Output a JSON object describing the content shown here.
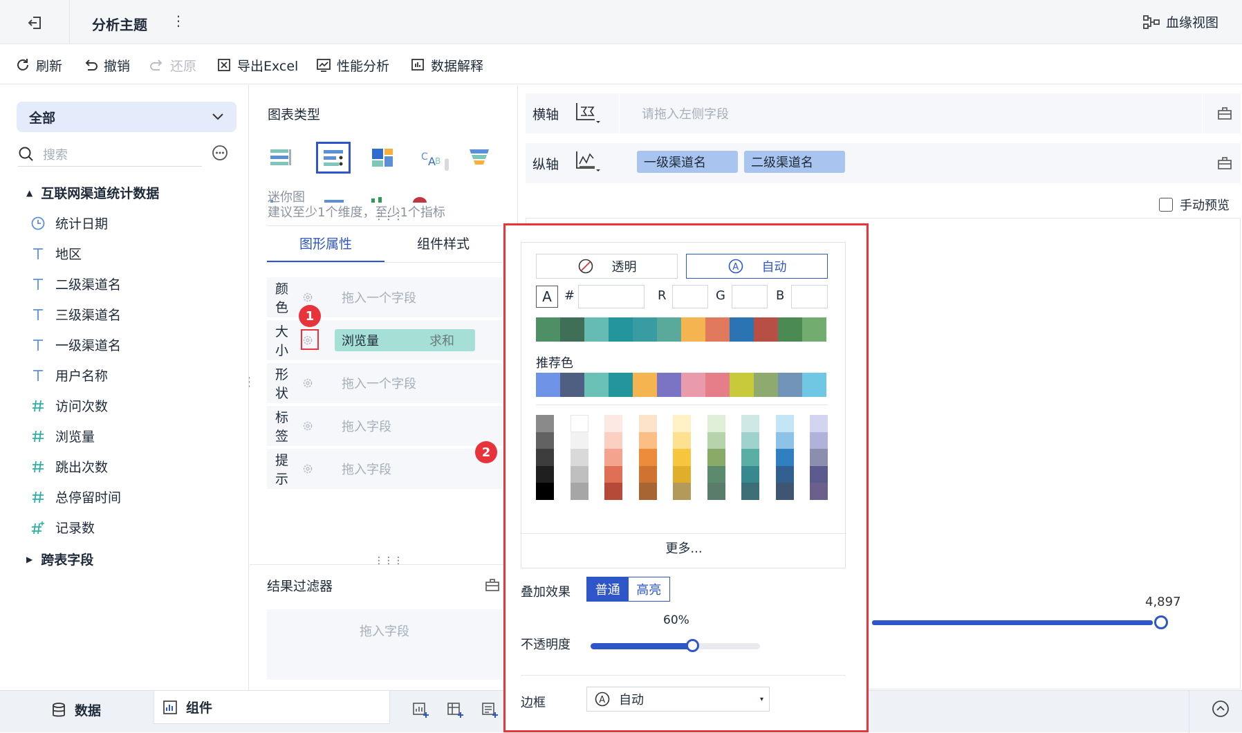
{
  "topbar": {
    "title": "分析主题",
    "more": "⋮",
    "lineage": "血缘视图"
  },
  "toolbar": {
    "refresh": "刷新",
    "undo": "撤销",
    "redo": "还原",
    "export": "导出Excel",
    "perf": "性能分析",
    "explain": "数据解释"
  },
  "left": {
    "dropdown": "全部",
    "search_placeholder": "搜索",
    "group": "互联网渠道统计数据",
    "fields": [
      {
        "label": "统计日期",
        "icon": "clock-icon"
      },
      {
        "label": "地区",
        "icon": "text-field-icon"
      },
      {
        "label": "二级渠道名",
        "icon": "text-field-icon"
      },
      {
        "label": "三级渠道名",
        "icon": "text-field-icon"
      },
      {
        "label": "一级渠道名",
        "icon": "text-field-icon"
      },
      {
        "label": "用户名称",
        "icon": "text-field-icon"
      },
      {
        "label": "访问次数",
        "icon": "number-field-icon"
      },
      {
        "label": "浏览量",
        "icon": "number-field-icon"
      },
      {
        "label": "跳出次数",
        "icon": "number-field-icon"
      },
      {
        "label": "总停留时间",
        "icon": "number-field-icon"
      },
      {
        "label": "记录数",
        "icon": "count-field-icon"
      }
    ],
    "cross_table": "跨表字段"
  },
  "mid": {
    "chart_type_title": "图表类型",
    "mini_name": "迷你图",
    "mini_hint": "建议至少1个维度，至少1个指标",
    "tab_props": "图形属性",
    "tab_style": "组件样式",
    "props": [
      {
        "label": "颜色",
        "placeholder": "拖入一个字段"
      },
      {
        "label": "大小",
        "pill": "浏览量",
        "agg": "求和"
      },
      {
        "label": "形状",
        "placeholder": "拖入一个字段"
      },
      {
        "label": "标签",
        "placeholder": "拖入字段"
      },
      {
        "label": "提示",
        "placeholder": "拖入字段"
      }
    ],
    "filter_title": "结果过滤器",
    "filter_placeholder": "拖入字段"
  },
  "right": {
    "x_axis": "横轴",
    "x_placeholder": "请拖入左侧字段",
    "y_axis": "纵轴",
    "y_pills": [
      "一级渠道名",
      "二级渠道名"
    ],
    "manual_preview": "手动预览",
    "value_label": "4,897"
  },
  "popup": {
    "transparent": "透明",
    "auto": "自动",
    "hash": "#",
    "r": "R",
    "g": "G",
    "b": "B",
    "palette": [
      "#4e8f66",
      "#3f6f57",
      "#66bcb4",
      "#23959c",
      "#3a9ca3",
      "#5aaa9c",
      "#f4b550",
      "#e17a5c",
      "#2a74b4",
      "#b84f44",
      "#4c8a53",
      "#72ad6f"
    ],
    "recommended_title": "推荐色",
    "recommended": [
      "#6f93e6",
      "#4f5f82",
      "#6bc1b6",
      "#23959c",
      "#f4b550",
      "#7b73c4",
      "#e99aab",
      "#e57e88",
      "#c8c93b",
      "#8faa6f",
      "#7193b8",
      "#6fc7e4"
    ],
    "shade_columns": [
      [
        "#8a8a8a",
        "#626262",
        "#3c3c3c",
        "#1f1f1f",
        "#000000"
      ],
      [
        "#ffffff",
        "#f2f2f2",
        "#d9d9d9",
        "#bfbfbf",
        "#a6a6a6"
      ],
      [
        "#fde9e4",
        "#fccfc3",
        "#f4a38f",
        "#df6f55",
        "#b54a39"
      ],
      [
        "#fde3c9",
        "#fbbe84",
        "#ec8c3a",
        "#cf7330",
        "#a66532"
      ],
      [
        "#fff1c6",
        "#fde191",
        "#f8c63c",
        "#e0ae2b",
        "#b39a5b"
      ],
      [
        "#dfeed7",
        "#b6d4ac",
        "#89ab68",
        "#5b8b6c",
        "#5a7d6b"
      ],
      [
        "#cfe8e6",
        "#9fd2cc",
        "#5aaea3",
        "#38898f",
        "#3c6e77"
      ],
      [
        "#c4e5f5",
        "#8ec2e6",
        "#2f7fc1",
        "#315f90",
        "#3f5673"
      ],
      [
        "#d3d4ef",
        "#b1b2dc",
        "#8b8eac",
        "#5a5a8f",
        "#6a5f8d"
      ]
    ],
    "more": "更多...",
    "blend_title": "叠加效果",
    "blend_normal": "普通",
    "blend_highlight": "高亮",
    "opacity_value": "60%",
    "opacity_title": "不透明度",
    "opacity_fraction": 0.6,
    "border_title": "边框",
    "border_value": "自动"
  },
  "badges": {
    "one": "1",
    "two": "2"
  },
  "bottom": {
    "data": "数据",
    "component": "组件"
  }
}
